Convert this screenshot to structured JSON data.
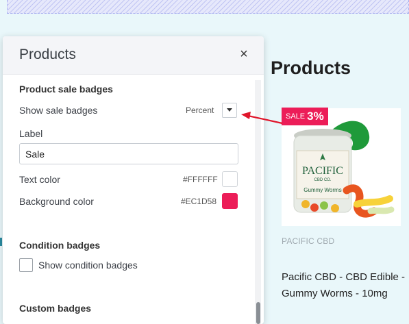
{
  "storefront": {
    "heading": "Products",
    "badge": {
      "label": "SALE",
      "percent": "3%"
    },
    "product": {
      "brand": "PACIFIC CBD",
      "name": "Pacific CBD - CBD Edible - Gummy Worms - 10mg",
      "image_logo": "PACIFIC",
      "image_sub": "CBD CO.",
      "image_product": "Gummy Worms"
    }
  },
  "panel": {
    "title": "Products",
    "close": "×",
    "sale_badges": {
      "heading": "Product sale badges",
      "show_label": "Show sale badges",
      "show_value": "Percent",
      "label_label": "Label",
      "label_value": "Sale",
      "text_color_label": "Text color",
      "text_color_value": "#FFFFFF",
      "bg_color_label": "Background color",
      "bg_color_value": "#EC1D58"
    },
    "condition_badges": {
      "heading": "Condition badges",
      "show_label": "Show condition badges",
      "checked": false
    },
    "custom_badges": {
      "heading": "Custom badges"
    }
  },
  "colors": {
    "badge_bg": "#EC1D58",
    "badge_text": "#FFFFFF",
    "arrow": "#e0162b"
  }
}
